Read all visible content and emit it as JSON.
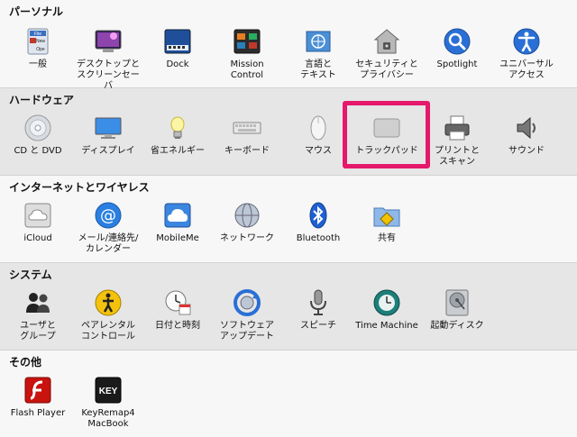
{
  "sections": {
    "personal": {
      "title": "パーソナル",
      "items": [
        {
          "label": "一般"
        },
        {
          "label": "デスクトップと\nスクリーンセーバ"
        },
        {
          "label": "Dock"
        },
        {
          "label": "Mission\nControl"
        },
        {
          "label": "言語と\nテキスト"
        },
        {
          "label": "セキュリティと\nプライバシー"
        },
        {
          "label": "Spotlight"
        },
        {
          "label": "ユニバーサル\nアクセス"
        }
      ]
    },
    "hardware": {
      "title": "ハードウェア",
      "items": [
        {
          "label": "CD と DVD"
        },
        {
          "label": "ディスプレイ"
        },
        {
          "label": "省エネルギー"
        },
        {
          "label": "キーボード"
        },
        {
          "label": "マウス"
        },
        {
          "label": "トラックパッド"
        },
        {
          "label": "プリントと\nスキャン"
        },
        {
          "label": "サウンド"
        }
      ]
    },
    "internet": {
      "title": "インターネットとワイヤレス",
      "items": [
        {
          "label": "iCloud"
        },
        {
          "label": "メール/連絡先/\nカレンダー"
        },
        {
          "label": "MobileMe"
        },
        {
          "label": "ネットワーク"
        },
        {
          "label": "Bluetooth"
        },
        {
          "label": "共有"
        }
      ]
    },
    "system": {
      "title": "システム",
      "items": [
        {
          "label": "ユーザと\nグループ"
        },
        {
          "label": "ペアレンタル\nコントロール"
        },
        {
          "label": "日付と時刻"
        },
        {
          "label": "ソフトウェア\nアップデート"
        },
        {
          "label": "スピーチ"
        },
        {
          "label": "Time Machine"
        },
        {
          "label": "起動ディスク"
        }
      ]
    },
    "other": {
      "title": "その他",
      "items": [
        {
          "label": "Flash Player"
        },
        {
          "label": "KeyRemap4\nMacBook"
        }
      ]
    }
  },
  "icon_text": {
    "general_file": "File",
    "general_new": "New",
    "general_open": "Ope",
    "keyremap_key": "KEY"
  },
  "colors": {
    "highlight": "#e5196b"
  }
}
